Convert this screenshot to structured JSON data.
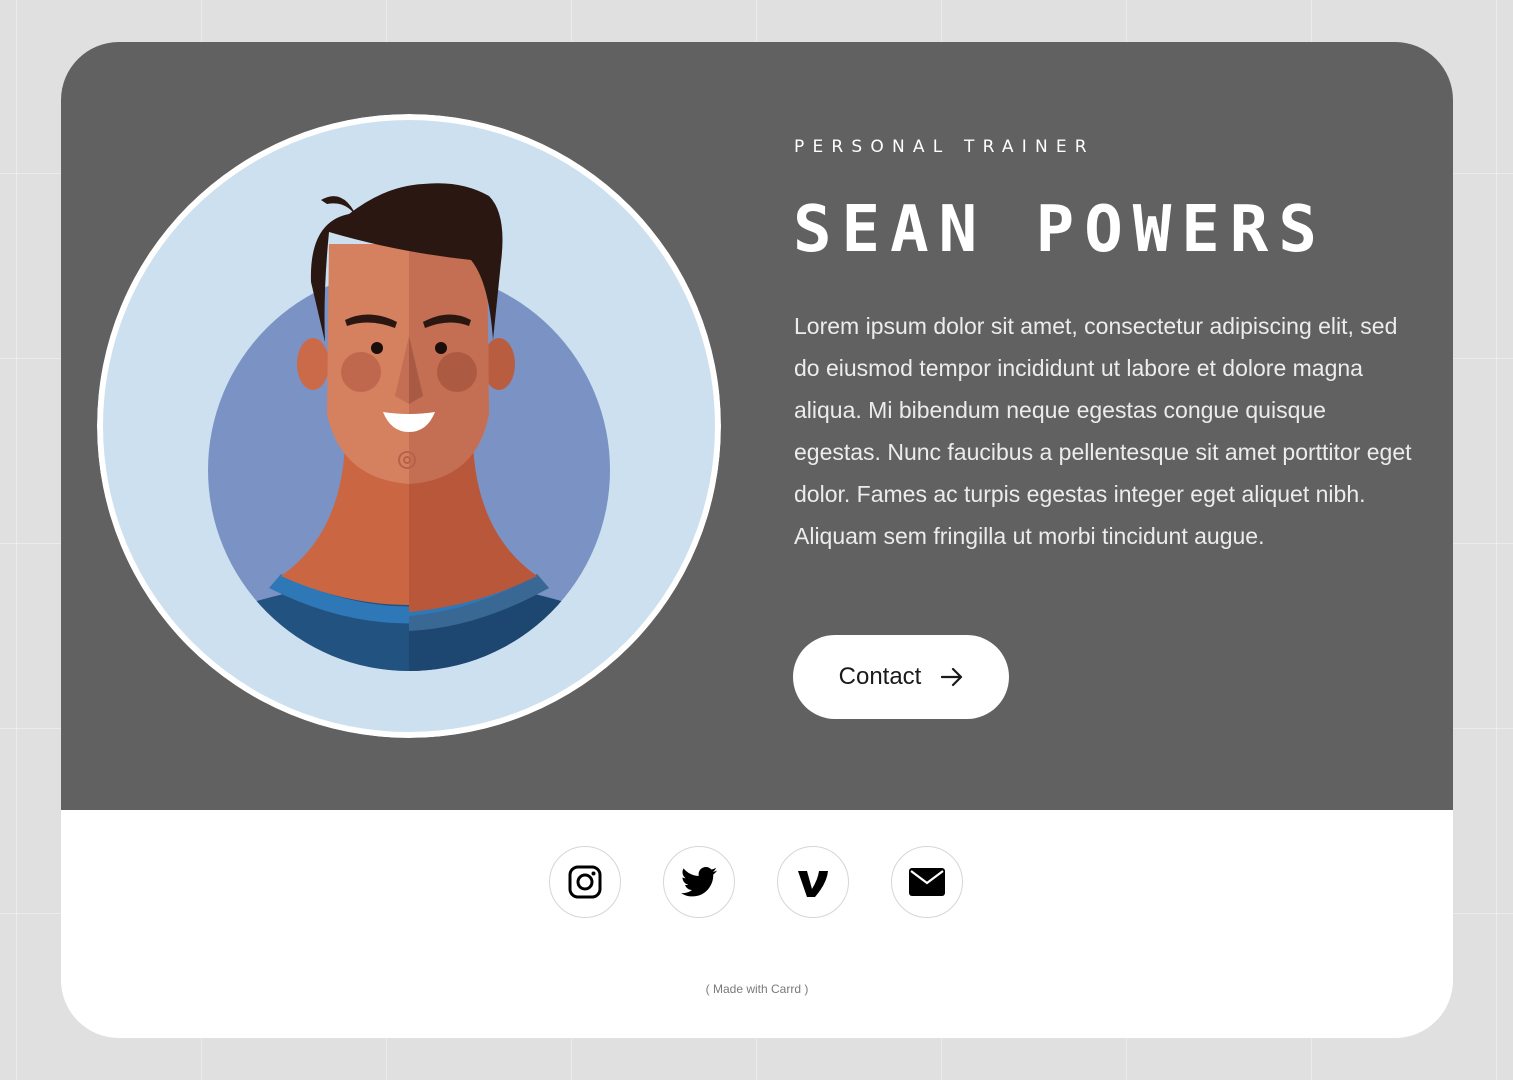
{
  "profile": {
    "role": "PERSONAL TRAINER",
    "name": "SEAN POWERS",
    "bio": "Lorem ipsum dolor sit amet, consectetur adipiscing elit, sed do eiusmod tempor incididunt ut labore et dolore magna aliqua. Mi bibendum neque egestas congue quisque egestas. Nunc faucibus a pellentesque sit amet porttitor eget dolor. Fames ac turpis egestas integer eget aliquet nibh. Aliquam sem fringilla ut morbi tincidunt augue."
  },
  "contact": {
    "label": "Contact",
    "icon": "arrow-right-icon"
  },
  "avatar": {
    "icon": "man-portrait-illustration"
  },
  "socials": [
    {
      "name": "instagram",
      "icon": "instagram-icon"
    },
    {
      "name": "twitter",
      "icon": "twitter-icon"
    },
    {
      "name": "vimeo",
      "icon": "vimeo-icon"
    },
    {
      "name": "email",
      "icon": "envelope-icon"
    }
  ],
  "footer": {
    "credit": "( Made with Carrd )"
  },
  "colors": {
    "page_background": "#e0e0e0",
    "hero_background": "#616161",
    "card_background": "#ffffff",
    "avatar_backdrop": "#cce0f0",
    "avatar_circle": "#7b93c4"
  }
}
